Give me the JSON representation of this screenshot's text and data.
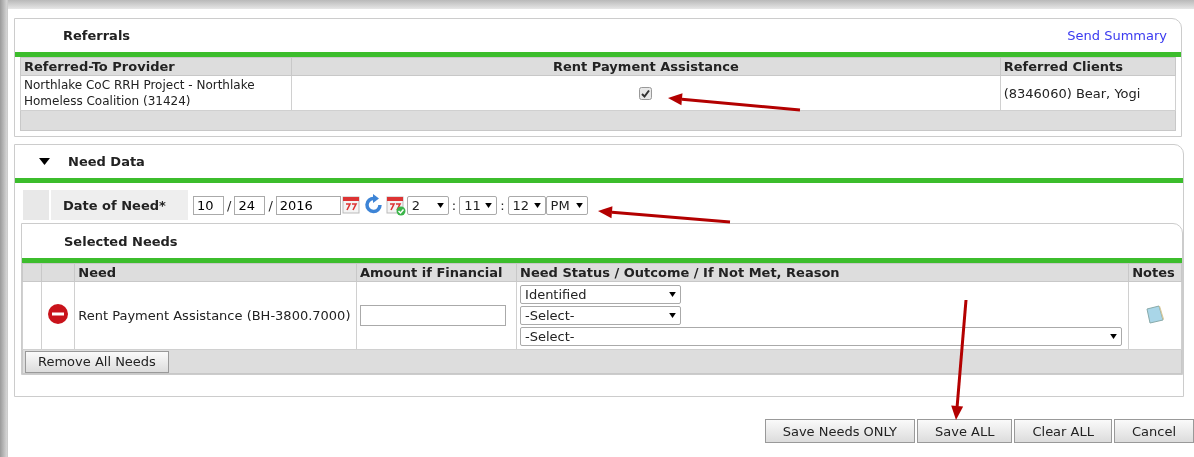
{
  "referrals": {
    "title": "Referrals",
    "link": "Send Summary",
    "columns": [
      "Referred-To Provider",
      "Rent Payment Assistance",
      "Referred Clients"
    ],
    "rows": [
      {
        "provider": "Northlake CoC RRH Project - Northlake Homeless Coalition (31424)",
        "checked": true,
        "client": "(8346060) Bear, Yogi"
      }
    ]
  },
  "need_data": {
    "title": "Need Data",
    "expanded": true,
    "date_label": "Date of Need",
    "required_mark": "*",
    "date_fields": [
      "10",
      "24",
      "2016"
    ],
    "date_separators": [
      "/",
      "/"
    ],
    "time_fields": [
      "2",
      "11",
      "12",
      "PM"
    ],
    "time_separators": [
      ":",
      ":"
    ],
    "selected_needs": {
      "title": "Selected Needs",
      "columns": [
        "Need",
        "Amount if Financial",
        "Need Status / Outcome / If Not Met, Reason",
        "Notes"
      ],
      "rows": [
        {
          "need": "Rent Payment Assistance (BH-3800.7000)",
          "status": "Identified",
          "outcome": "-Select-",
          "reason": "-Select-"
        }
      ],
      "remove_all": "Remove All Needs"
    }
  },
  "buttons": [
    "Save Needs ONLY",
    "Save ALL",
    "Clear ALL",
    "Cancel"
  ]
}
